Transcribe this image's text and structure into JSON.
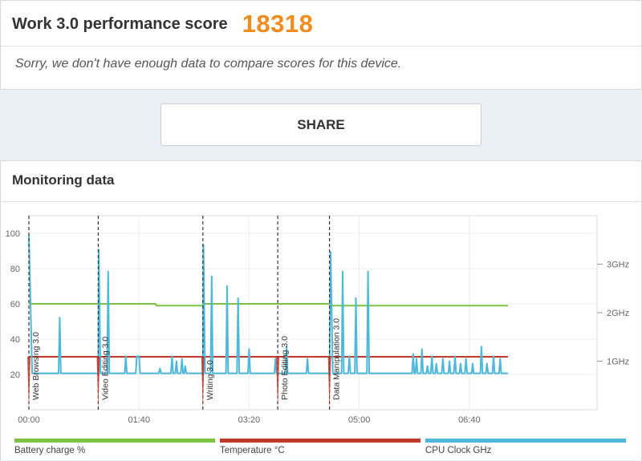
{
  "score": {
    "title": "Work 3.0 performance score",
    "value": "18318",
    "note": "Sorry, we don't have enough data to compare scores for this device."
  },
  "share": {
    "label": "SHARE"
  },
  "monitoring": {
    "title": "Monitoring data"
  },
  "colors": {
    "battery": "#7cc142",
    "temperature": "#c0392b",
    "cpu": "#4db8da",
    "accent": "#f08c1e"
  },
  "chart_data": {
    "type": "line",
    "x_unit": "time (mm:ss)",
    "xlim": [
      0,
      516
    ],
    "ylim_left": [
      0,
      110
    ],
    "ylim_right_ghz": [
      0,
      4.0
    ],
    "x_ticks": [
      {
        "t": 0,
        "label": "00:00"
      },
      {
        "t": 100,
        "label": "01:40"
      },
      {
        "t": 200,
        "label": "03:20"
      },
      {
        "t": 300,
        "label": "05:00"
      },
      {
        "t": 400,
        "label": "06:40"
      }
    ],
    "y_ticks_left": [
      20,
      40,
      60,
      80,
      100
    ],
    "y_ticks_right": [
      {
        "v": 1,
        "label": "1GHz"
      },
      {
        "v": 2,
        "label": "2GHz"
      },
      {
        "v": 3,
        "label": "3GHz"
      }
    ],
    "phases": [
      {
        "t": 0,
        "label": "Web Browsing 3.0"
      },
      {
        "t": 63,
        "label": "Video Editing 3.0"
      },
      {
        "t": 158,
        "label": "Writing 3.0"
      },
      {
        "t": 226,
        "label": "Photo Editing 3.0"
      },
      {
        "t": 273,
        "label": "Data Manipulation 3.0"
      }
    ],
    "series": [
      {
        "name": "Battery charge %",
        "axis": "left",
        "points": [
          [
            0,
            60
          ],
          [
            115,
            60
          ],
          [
            116,
            59
          ],
          [
            158,
            59
          ],
          [
            159,
            60
          ],
          [
            273,
            60
          ],
          [
            274,
            59
          ],
          [
            435,
            59
          ]
        ]
      },
      {
        "name": "Temperature °C",
        "axis": "left",
        "points": [
          [
            0,
            30
          ],
          [
            435,
            30
          ]
        ]
      },
      {
        "name": "CPU Clock GHz",
        "axis": "right",
        "points": [
          [
            0,
            3.6
          ],
          [
            3,
            0.75
          ],
          [
            27,
            0.75
          ],
          [
            28,
            1.9
          ],
          [
            29,
            0.75
          ],
          [
            63,
            0.75
          ],
          [
            63.5,
            3.3
          ],
          [
            65,
            0.75
          ],
          [
            71,
            0.75
          ],
          [
            72,
            2.85
          ],
          [
            73,
            0.75
          ],
          [
            87,
            0.75
          ],
          [
            88,
            1.1
          ],
          [
            89,
            0.75
          ],
          [
            97,
            0.75
          ],
          [
            98,
            1.1
          ],
          [
            100,
            1.1
          ],
          [
            101,
            0.75
          ],
          [
            118,
            0.75
          ],
          [
            119,
            0.85
          ],
          [
            120,
            0.75
          ],
          [
            129,
            0.75
          ],
          [
            130,
            1.1
          ],
          [
            131,
            0.75
          ],
          [
            133,
            0.75
          ],
          [
            134,
            1.0
          ],
          [
            135,
            0.75
          ],
          [
            138,
            0.75
          ],
          [
            139,
            1.05
          ],
          [
            140,
            0.75
          ],
          [
            141,
            0.75
          ],
          [
            142,
            0.9
          ],
          [
            143,
            0.75
          ],
          [
            158,
            0.75
          ],
          [
            158.5,
            3.4
          ],
          [
            160,
            0.75
          ],
          [
            165,
            0.75
          ],
          [
            166,
            2.75
          ],
          [
            167,
            0.75
          ],
          [
            179,
            0.75
          ],
          [
            180,
            2.55
          ],
          [
            181,
            0.75
          ],
          [
            189,
            0.75
          ],
          [
            190,
            2.3
          ],
          [
            191,
            0.75
          ],
          [
            199,
            0.75
          ],
          [
            200,
            1.25
          ],
          [
            201,
            0.75
          ],
          [
            223,
            0.75
          ],
          [
            224,
            1.05
          ],
          [
            225,
            0.75
          ],
          [
            233,
            0.75
          ],
          [
            234,
            1.3
          ],
          [
            235,
            0.75
          ],
          [
            252,
            0.75
          ],
          [
            253,
            1.05
          ],
          [
            254,
            0.75
          ],
          [
            273,
            0.75
          ],
          [
            274,
            3.25
          ],
          [
            276,
            0.75
          ],
          [
            284,
            0.75
          ],
          [
            285,
            2.85
          ],
          [
            286,
            0.75
          ],
          [
            290,
            0.75
          ],
          [
            291,
            1.1
          ],
          [
            292,
            0.75
          ],
          [
            296,
            0.75
          ],
          [
            297,
            2.3
          ],
          [
            298,
            0.75
          ],
          [
            307,
            0.75
          ],
          [
            308,
            2.85
          ],
          [
            309,
            0.75
          ],
          [
            348,
            0.75
          ],
          [
            349,
            1.15
          ],
          [
            350,
            0.75
          ],
          [
            351,
            0.75
          ],
          [
            352,
            1.05
          ],
          [
            353,
            0.75
          ],
          [
            356,
            0.75
          ],
          [
            357,
            1.25
          ],
          [
            358,
            0.75
          ],
          [
            361,
            0.75
          ],
          [
            362,
            0.9
          ],
          [
            363,
            0.75
          ],
          [
            365,
            0.75
          ],
          [
            366,
            1.1
          ],
          [
            367,
            0.75
          ],
          [
            369,
            0.75
          ],
          [
            370,
            0.95
          ],
          [
            371,
            0.75
          ],
          [
            375,
            0.75
          ],
          [
            376,
            1.05
          ],
          [
            377,
            0.75
          ],
          [
            381,
            0.75
          ],
          [
            382,
            1.0
          ],
          [
            383,
            0.75
          ],
          [
            386,
            0.75
          ],
          [
            387,
            1.1
          ],
          [
            388,
            0.75
          ],
          [
            391,
            0.75
          ],
          [
            392,
            0.95
          ],
          [
            393,
            0.75
          ],
          [
            396,
            0.75
          ],
          [
            397,
            1.05
          ],
          [
            398,
            0.75
          ],
          [
            402,
            0.75
          ],
          [
            403,
            0.95
          ],
          [
            404,
            0.75
          ],
          [
            410,
            0.75
          ],
          [
            411,
            1.3
          ],
          [
            412,
            0.75
          ],
          [
            415,
            0.75
          ],
          [
            416,
            0.95
          ],
          [
            417,
            0.75
          ],
          [
            421,
            0.75
          ],
          [
            422,
            1.1
          ],
          [
            423,
            0.75
          ],
          [
            427,
            0.75
          ],
          [
            428,
            1.05
          ],
          [
            429,
            0.75
          ],
          [
            435,
            0.75
          ]
        ]
      }
    ]
  }
}
